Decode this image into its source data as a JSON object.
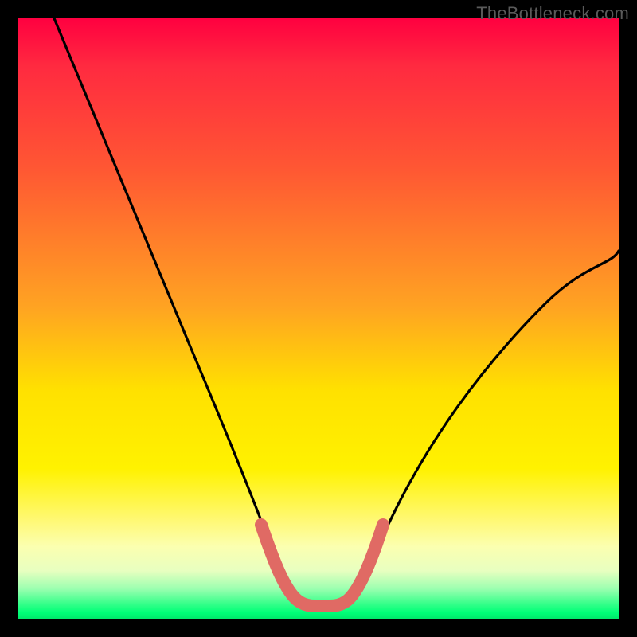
{
  "watermark": "TheBottleneck.com",
  "colors": {
    "curve_main": "#000000",
    "curve_highlight": "#e06a64",
    "background": "#000000"
  },
  "chart_data": {
    "type": "line",
    "title": "",
    "xlabel": "",
    "ylabel": "",
    "xlim": [
      0,
      100
    ],
    "ylim": [
      0,
      100
    ],
    "grid": false,
    "series": [
      {
        "name": "bottleneck-curve",
        "x": [
          6,
          10,
          15,
          20,
          25,
          30,
          35,
          40,
          43,
          46,
          50,
          53,
          56,
          61,
          67,
          74,
          82,
          90,
          100
        ],
        "y": [
          100,
          90,
          77,
          65,
          53,
          41,
          30,
          19,
          12,
          7,
          3,
          3,
          7,
          15,
          24,
          34,
          44,
          52,
          61
        ],
        "color": "#000000"
      },
      {
        "name": "highlight-bottom",
        "x": [
          40,
          43,
          46,
          50,
          53,
          56
        ],
        "y": [
          19,
          12,
          7,
          3,
          3,
          7
        ],
        "color": "#e06a64"
      }
    ]
  }
}
